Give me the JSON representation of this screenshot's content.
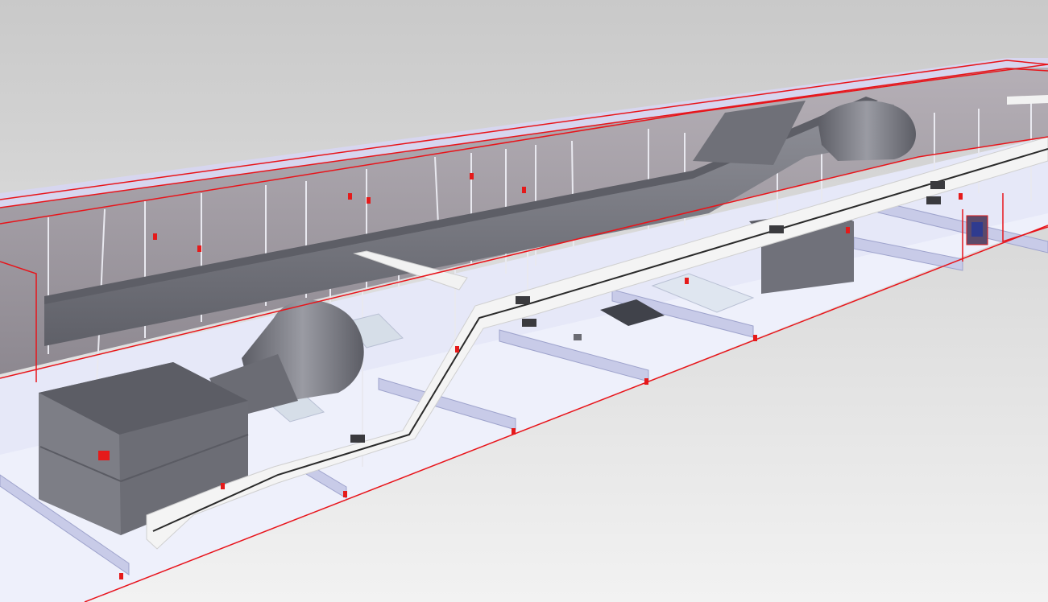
{
  "viewport": {
    "background_top": "#c9c9c9",
    "background_bottom": "#f2f2f2"
  },
  "colors": {
    "section_outline": "#e8141a",
    "wall": "#a8a3aa",
    "wall_light": "#c8c2c8",
    "duct": "#72737b",
    "duct_top": "#5d5e66",
    "duct_light": "#8f9098",
    "cable_tray": "#f4f4f4",
    "cable_tray_shade": "#cfcfcf",
    "cable_line": "#2a2a2a",
    "floor": "#eef0fb",
    "rail": "#c8cbe8",
    "rail_shade": "#9ea3cc",
    "hanger_rod": "#e9e9f0",
    "marker": "#e51a1a",
    "clamp": "#3a3a3e"
  },
  "scene_objects": [
    "section-box",
    "ceiling-wall",
    "supply-duct",
    "elbow-duct",
    "air-handling-unit",
    "cable-tray",
    "hanger-rods",
    "floor-rails",
    "diffusers",
    "wall-panel-device"
  ]
}
